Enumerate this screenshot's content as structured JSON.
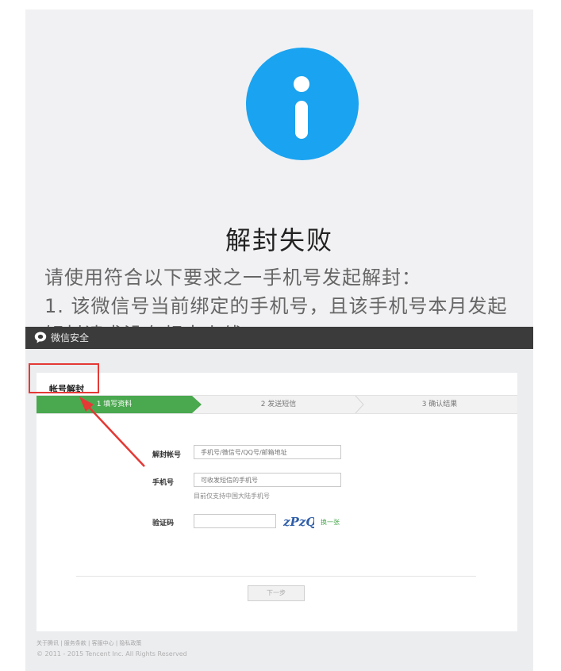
{
  "notice": {
    "title": "解封失败",
    "body_lines": [
      "请使用符合以下要求之一手机号发起解封：",
      "1. 该微信号当前绑定的手机号，且该手机号本月发起",
      "解封请求没有超出上线"
    ],
    "icon": "info-icon",
    "accent_color": "#1aa3f0"
  },
  "desktop": {
    "brand": "微信安全",
    "panel_title": "帐号解封",
    "steps": [
      {
        "label": "1 填写资料",
        "active": true
      },
      {
        "label": "2 发送短信",
        "active": false
      },
      {
        "label": "3 确认结果",
        "active": false
      }
    ],
    "form": {
      "account": {
        "label": "解封帐号",
        "placeholder": "手机号/微信号/QQ号/邮箱地址"
      },
      "phone": {
        "label": "手机号",
        "placeholder": "可收发短信的手机号",
        "hint": "目前仅支持中国大陆手机号"
      },
      "captcha": {
        "label": "验证码",
        "image_text": "zPzQ",
        "refresh": "换一张"
      }
    },
    "next_button": "下一步",
    "footer_links": "关于腾讯 | 服务条款 | 客服中心 | 隐私政策",
    "copyright": "© 2011 - 2015 Tencent Inc. All Rights Reserved",
    "accent_color": "#4aa84f"
  }
}
